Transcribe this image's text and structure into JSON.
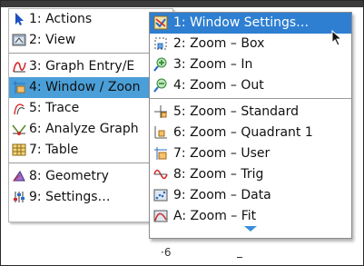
{
  "background": {
    "axis_label": "·6"
  },
  "main_menu": {
    "items": [
      {
        "label": "1: Actions",
        "icon": "pointer-arrow-icon"
      },
      {
        "label": "2: View",
        "icon": "view-icon"
      },
      {
        "label": "3: Graph Entry/E",
        "icon": "graph-entry-icon"
      },
      {
        "label": "4: Window / Zoon",
        "icon": "window-zoom-icon",
        "selected": true
      },
      {
        "label": "5: Trace",
        "icon": "trace-icon"
      },
      {
        "label": "6: Analyze Graph",
        "icon": "analyze-graph-icon"
      },
      {
        "label": "7: Table",
        "icon": "table-icon"
      },
      {
        "label": "8: Geometry",
        "icon": "geometry-icon"
      },
      {
        "label": "9: Settings…",
        "icon": "settings-icon"
      }
    ]
  },
  "submenu": {
    "items": [
      {
        "label": "1: Window Settings…",
        "icon": "window-settings-icon",
        "selected": true
      },
      {
        "label": "2: Zoom – Box",
        "icon": "zoom-box-icon"
      },
      {
        "label": "3: Zoom – In",
        "icon": "zoom-in-icon"
      },
      {
        "label": "4: Zoom – Out",
        "icon": "zoom-out-icon"
      },
      {
        "label": "5: Zoom – Standard",
        "icon": "zoom-standard-icon"
      },
      {
        "label": "6: Zoom – Quadrant 1",
        "icon": "zoom-quadrant-icon"
      },
      {
        "label": "7: Zoom – User",
        "icon": "zoom-user-icon"
      },
      {
        "label": "8: Zoom – Trig",
        "icon": "zoom-trig-icon"
      },
      {
        "label": "9: Zoom – Data",
        "icon": "zoom-data-icon"
      },
      {
        "label": "A: Zoom – Fit",
        "icon": "zoom-fit-icon"
      }
    ]
  },
  "colors": {
    "main_selection": "#4a9fd8",
    "sub_selection": "#2e7fd1",
    "scroll_arrow": "#3a8fd8"
  }
}
